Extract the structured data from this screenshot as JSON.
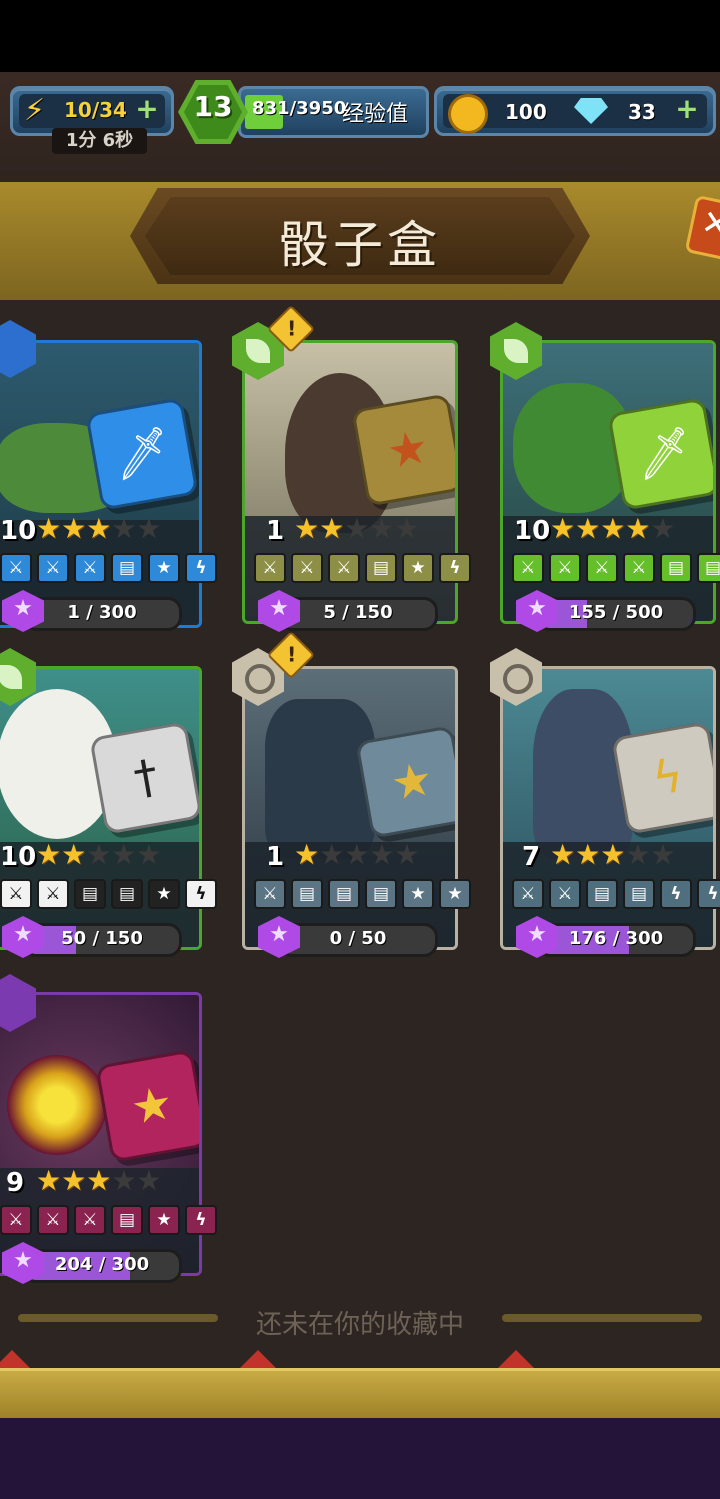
{
  "hud": {
    "energy": "10/34",
    "timer": "1分 6秒",
    "level": "13",
    "xp": "831/3950",
    "xp_label": "经验值",
    "coins": "100",
    "gems": "33"
  },
  "header": {
    "title": "骰子盒"
  },
  "cards": [
    {
      "level": "10",
      "stars_filled": 3,
      "progress": "1 / 300",
      "progress_value": 0.003,
      "class_icon": "water-icon"
    },
    {
      "level": "1",
      "stars_filled": 2,
      "progress": "5 / 150",
      "progress_value": 0.033,
      "class_icon": "leaf-icon",
      "alert": "!"
    },
    {
      "level": "10",
      "stars_filled": 4,
      "progress": "155 / 500",
      "progress_value": 0.31,
      "class_icon": "leaf-icon"
    },
    {
      "level": "10",
      "stars_filled": 2,
      "progress": "50 / 150",
      "progress_value": 0.333,
      "class_icon": "leaf-icon"
    },
    {
      "level": "1",
      "stars_filled": 1,
      "progress": "0 / 50",
      "progress_value": 0,
      "class_icon": "swirl-icon",
      "alert": "!"
    },
    {
      "level": "7",
      "stars_filled": 3,
      "progress": "176 / 300",
      "progress_value": 0.587,
      "class_icon": "swirl-icon"
    },
    {
      "level": "9",
      "stars_filled": 3,
      "progress": "204 / 300",
      "progress_value": 0.68,
      "class_icon": "arcane-icon"
    }
  ],
  "footer": {
    "not_collected": "还未在你的收藏中"
  },
  "colors": {
    "background": "#2c2521",
    "hud_blue": "#2f5a7e",
    "level_green": "#5fae2d",
    "banner_gold": "#a98a2c",
    "star_gold": "#f6c22c",
    "progress_purple": "#9b56d8"
  }
}
